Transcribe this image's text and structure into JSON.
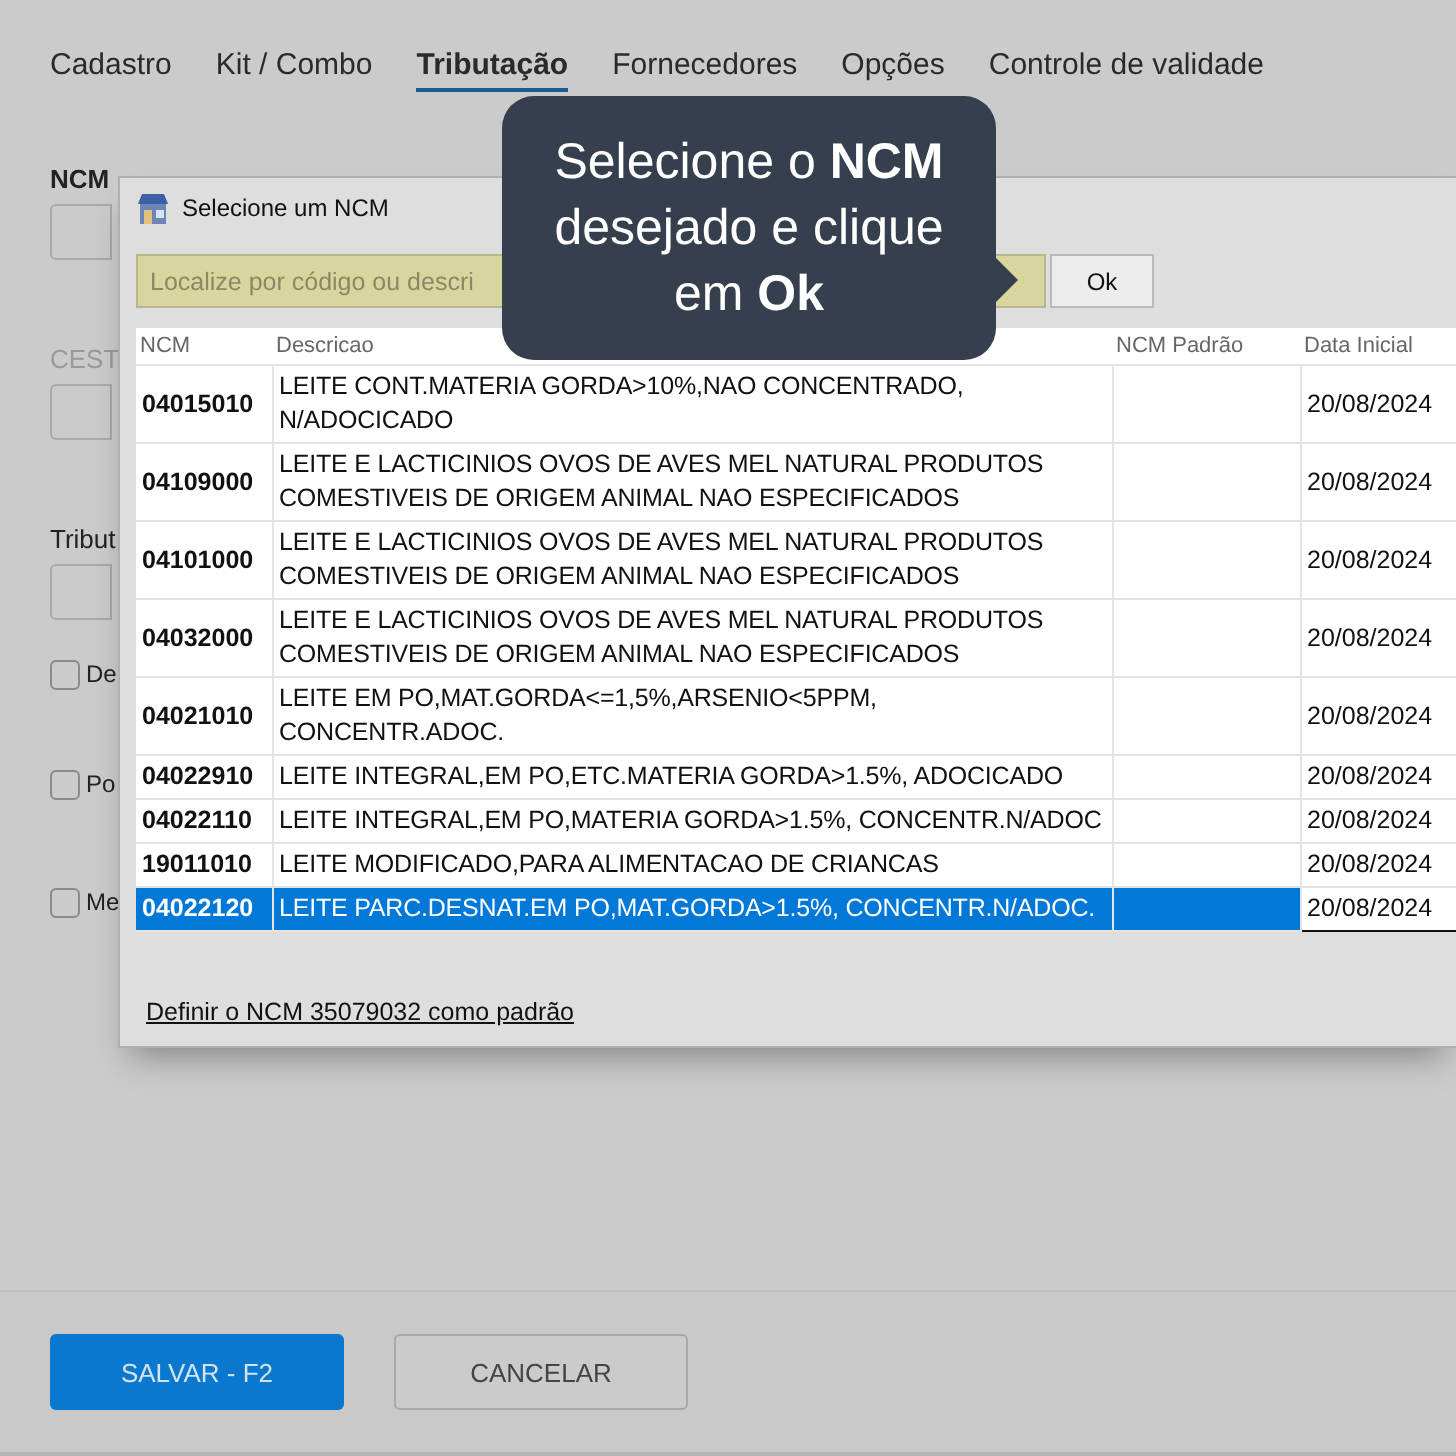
{
  "tabs": [
    {
      "label": "Cadastro",
      "selected": false
    },
    {
      "label": "Kit / Combo",
      "selected": false
    },
    {
      "label": "Tributação",
      "selected": true
    },
    {
      "label": "Fornecedores",
      "selected": false
    },
    {
      "label": "Opções",
      "selected": false
    },
    {
      "label": "Controle de validade",
      "selected": false
    }
  ],
  "form": {
    "fields": [
      {
        "label": "NCM",
        "disabled": false
      },
      {
        "label": "CEST",
        "disabled": true
      },
      {
        "label": "Tribut",
        "disabled": false
      }
    ],
    "checkboxes": [
      {
        "label": "De",
        "checked": false
      },
      {
        "label": "Po",
        "checked": false
      },
      {
        "label": "Me",
        "checked": false
      }
    ]
  },
  "dialog": {
    "title": "Selecione um NCM",
    "search": {
      "placeholder": "Localize por código ou descri"
    },
    "ok_button": "Ok",
    "columns": [
      "NCM",
      "Descricao",
      "NCM Padrão",
      "Data Inicial"
    ],
    "rows": [
      {
        "ncm": "04015010",
        "description": "LEITE CONT.MATERIA GORDA>10%,NAO CONCENTRADO, N/ADOCICADO",
        "date": "20/08/2024",
        "selected": false
      },
      {
        "ncm": "04109000",
        "description": "LEITE E LACTICINIOS OVOS DE AVES MEL NATURAL PRODUTOS COMESTIVEIS DE ORIGEM ANIMAL NAO ESPECIFICADOS",
        "date": "20/08/2024",
        "selected": false
      },
      {
        "ncm": "04101000",
        "description": "LEITE E LACTICINIOS OVOS DE AVES MEL NATURAL PRODUTOS COMESTIVEIS DE ORIGEM ANIMAL NAO ESPECIFICADOS",
        "date": "20/08/2024",
        "selected": false
      },
      {
        "ncm": "04032000",
        "description": "LEITE E LACTICINIOS OVOS DE AVES MEL NATURAL PRODUTOS COMESTIVEIS DE ORIGEM ANIMAL NAO ESPECIFICADOS",
        "date": "20/08/2024",
        "selected": false
      },
      {
        "ncm": "04021010",
        "description": "LEITE EM PO,MAT.GORDA<=1,5%,ARSENIO<5PPM, CONCENTR.ADOC.",
        "date": "20/08/2024",
        "selected": false
      },
      {
        "ncm": "04022910",
        "description": "LEITE INTEGRAL,EM PO,ETC.MATERIA GORDA>1.5%, ADOCICADO",
        "date": "20/08/2024",
        "selected": false
      },
      {
        "ncm": "04022110",
        "description": "LEITE INTEGRAL,EM PO,MATERIA GORDA>1.5%, CONCENTR.N/ADOC",
        "date": "20/08/2024",
        "selected": false
      },
      {
        "ncm": "19011010",
        "description": "LEITE MODIFICADO,PARA ALIMENTACAO DE CRIANCAS",
        "date": "20/08/2024",
        "selected": false
      },
      {
        "ncm": "04022120",
        "description": "LEITE PARC.DESNAT.EM PO,MAT.GORDA>1.5%, CONCENTR.N/ADOC.",
        "date": "20/08/2024",
        "selected": true
      }
    ],
    "link": "Definir o NCM 35079032 como padrão"
  },
  "tooltip": {
    "text": "Selecione o **NCM** desejado e clique em **Ok**"
  },
  "buttons": [
    {
      "label": "SALVAR - F2",
      "kind": "primary"
    },
    {
      "label": "CANCELAR",
      "kind": "secondary"
    }
  ]
}
